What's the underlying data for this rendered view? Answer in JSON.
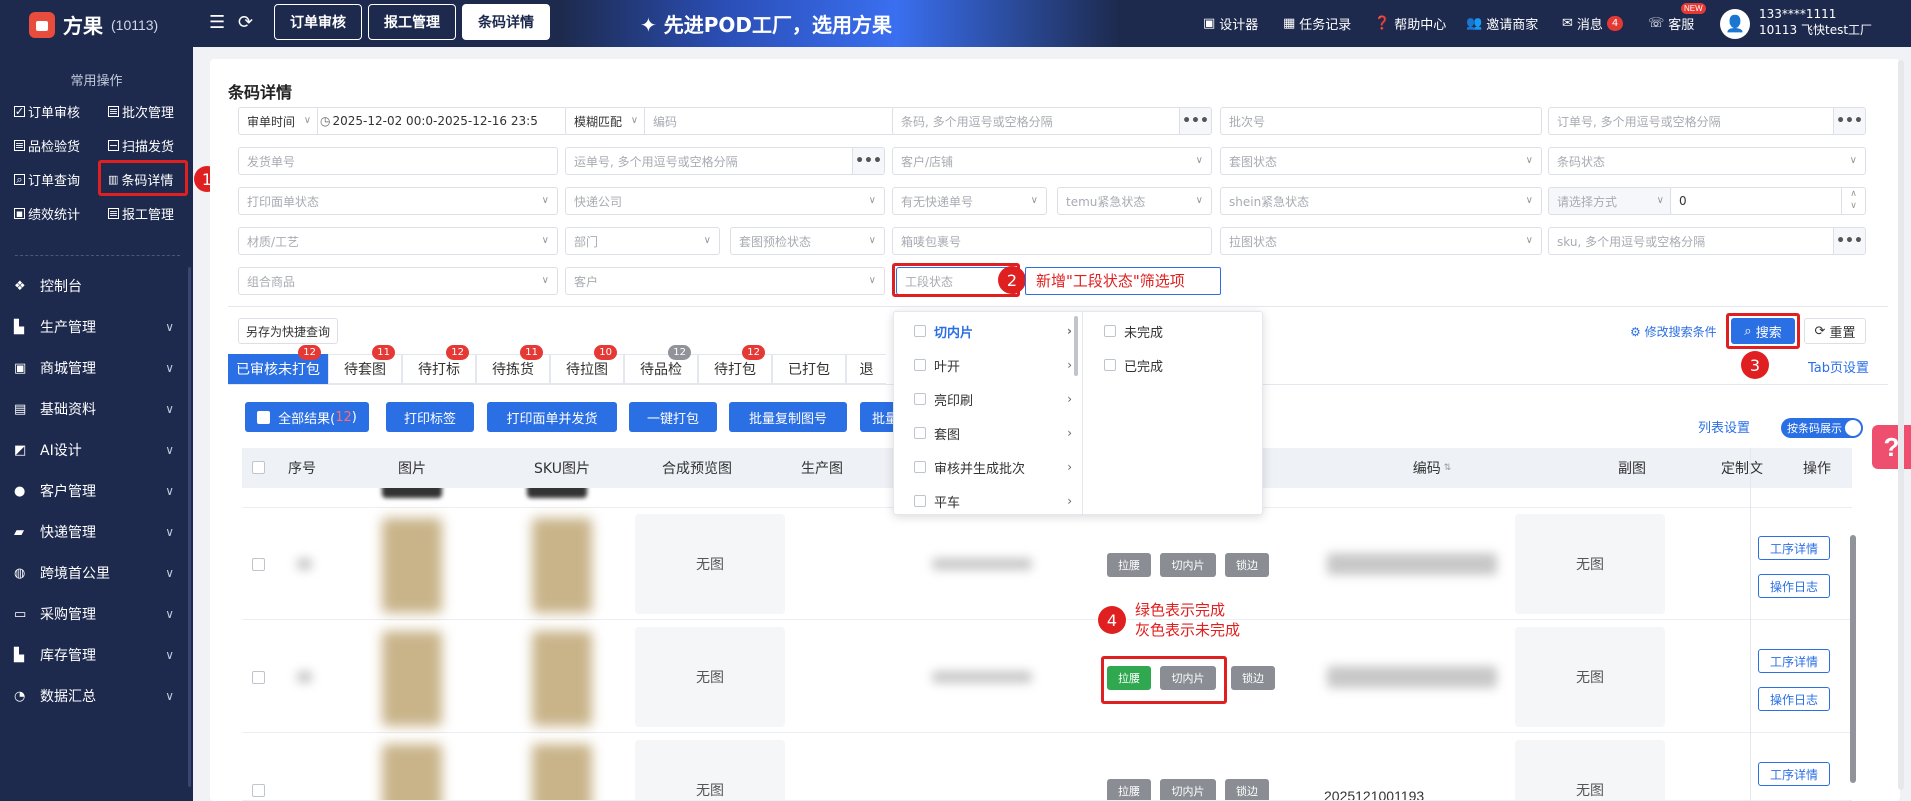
{
  "header": {
    "app_name": "方果",
    "app_id": "(10113)",
    "tabs": [
      "订单审核",
      "报工管理",
      "条码详情"
    ],
    "slogan": "先进POD工厂，选用方果",
    "links": {
      "designer": "设计器",
      "tasks": "任务记录",
      "help": "帮助中心",
      "invite": "邀请商家",
      "messages": "消息",
      "messages_count": "4",
      "service": "客服",
      "new_badge": "NEW"
    },
    "user_line1": "133****1111",
    "user_line2": "10113 飞快test工厂"
  },
  "sidebar": {
    "common_title": "常用操作",
    "quick": [
      "订单审核",
      "批次管理",
      "品检验货",
      "扫描发货",
      "订单查询",
      "条码详情",
      "绩效统计",
      "报工管理"
    ],
    "menu": [
      "控制台",
      "生产管理",
      "商城管理",
      "基础资料",
      "AI设计",
      "客户管理",
      "快递管理",
      "跨境首公里",
      "采购管理",
      "库存管理",
      "数据汇总"
    ]
  },
  "page": {
    "title": "条码详情",
    "filters": {
      "audit_time": "审单时间",
      "date_range": "2025-12-02 00:0-2025-12-16 23:5",
      "fuzzy": "模糊匹配",
      "code_ph": "编码",
      "barcode_ph": "条码, 多个用逗号或空格分隔",
      "batch_ph": "批次号",
      "order_ph": "订单号, 多个用逗号或空格分隔",
      "ship_order_ph": "发货单号",
      "waybill_ph": "运单号, 多个用逗号或空格分隔",
      "customer_shop_ph": "客户/店铺",
      "set_status_ph": "套图状态",
      "barcode_status_ph": "条码状态",
      "print_status_ph": "打印面单状态",
      "courier_ph": "快递公司",
      "has_courier_ph": "有无快递单号",
      "temu_ph": "temu紧急状态",
      "shein_ph": "shein紧急状态",
      "choose_method_ph": "请选择方式",
      "number_value": "0",
      "material_ph": "材质/工艺",
      "dept_ph": "部门",
      "set_precheck_ph": "套图预检状态",
      "box_ph": "箱唛包裹号",
      "pull_status_ph": "拉图状态",
      "sku_ph": "sku, 多个用逗号或空格分隔",
      "combo_ph": "组合商品",
      "customer_ph": "客户",
      "stage_status_ph": "工段状态"
    },
    "annotations": {
      "n1": "1",
      "n2": "2",
      "n3": "3",
      "n4": "4",
      "note2": "新增\"工段状态\"筛选项",
      "note4_line1": "绿色表示完成",
      "note4_line2": "灰色表示未完成"
    },
    "save_quick": "另存为快捷查询",
    "modify_cond": "修改搜索条件",
    "search": "搜索",
    "reset": "重置",
    "tab_settings": "Tab页设置",
    "tabs": [
      {
        "label": "已审核未打包",
        "count": "12"
      },
      {
        "label": "待套图",
        "count": "11"
      },
      {
        "label": "待打标",
        "count": "12"
      },
      {
        "label": "待拣货",
        "count": "11"
      },
      {
        "label": "待拉图",
        "count": "10"
      },
      {
        "label": "待品检",
        "count": "12"
      },
      {
        "label": "待打包",
        "count": "12"
      },
      {
        "label": "已打包",
        "count": ""
      },
      {
        "label": "退",
        "count": ""
      }
    ],
    "actions": {
      "all_results": "全部结果(",
      "all_count": "12",
      "all_close": ")",
      "print_label": "打印标签",
      "print_ship": "打印面单并发货",
      "one_pack": "一键打包",
      "batch_copy": "批量复制图号",
      "batch_more": "批量"
    },
    "list_settings": "列表设置",
    "barcode_toggle": "按条码展示",
    "columns": [
      "序号",
      "图片",
      "SKU图片",
      "合成预览图",
      "生产图",
      "编码",
      "副图",
      "定制文",
      "操作"
    ],
    "rows": [
      {
        "preview": "无图",
        "tags": [
          "拉腰",
          "切内片",
          "锁边"
        ],
        "sub": "无图",
        "op1": "工序详情",
        "op2": "操作日志"
      },
      {
        "preview": "无图",
        "tags": [
          "拉腰",
          "切内片",
          "锁边"
        ],
        "sub": "无图",
        "op1": "工序详情",
        "op2": "操作日志"
      },
      {
        "preview": "无图",
        "tags": [
          "拉腰",
          "切内片",
          "锁边"
        ],
        "sub": "无图",
        "op1": "工序详情",
        "code": "2025121001193"
      }
    ]
  },
  "dropdown": {
    "items": [
      "切内片",
      "叶开",
      "亮印刷",
      "套图",
      "审核并生成批次",
      "平车"
    ],
    "sub": [
      "未完成",
      "已完成"
    ]
  }
}
